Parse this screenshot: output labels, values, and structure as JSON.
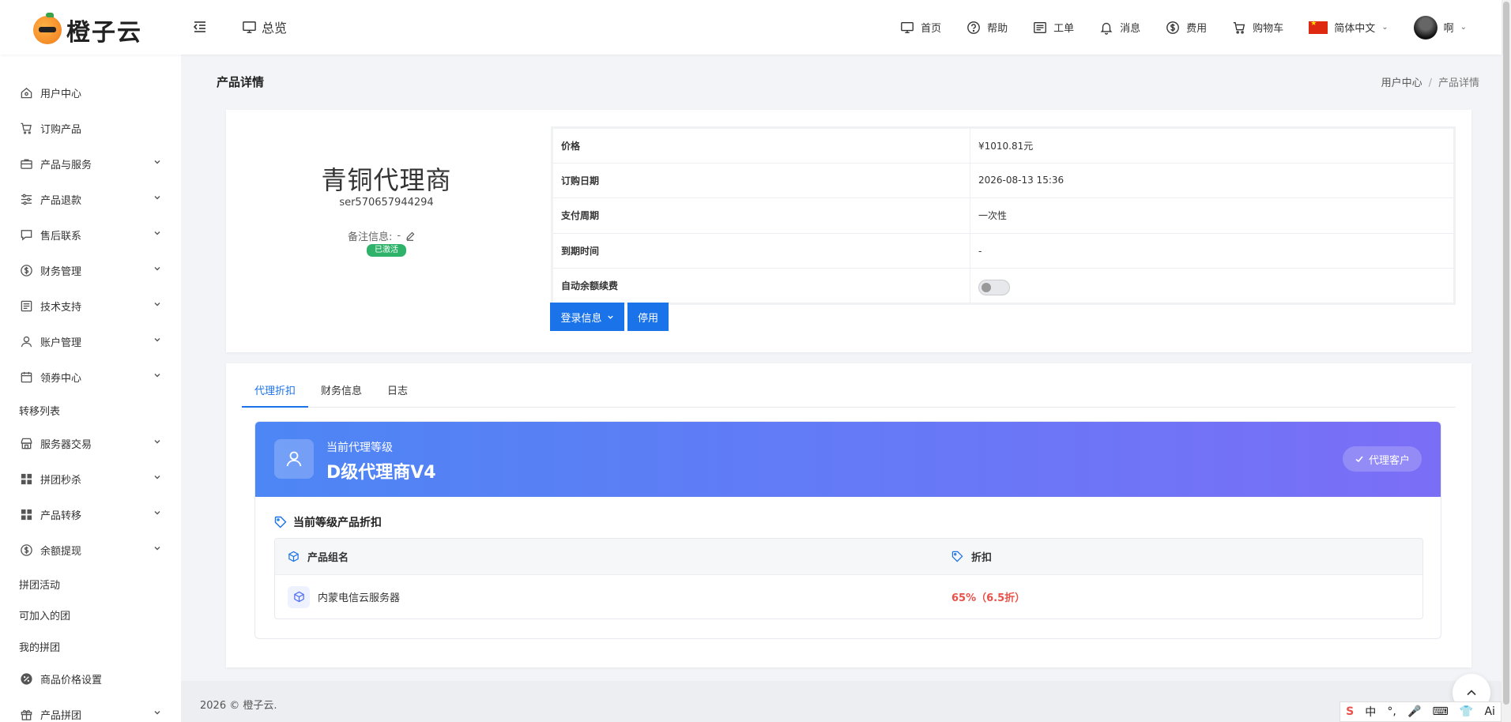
{
  "brand": {
    "name": "橙子云"
  },
  "header": {
    "overview": "总览",
    "nav": [
      {
        "label": "首页",
        "icon": "monitor-icon"
      },
      {
        "label": "帮助",
        "icon": "help-icon"
      },
      {
        "label": "工单",
        "icon": "ticket-icon"
      },
      {
        "label": "消息",
        "icon": "bell-icon"
      },
      {
        "label": "费用",
        "icon": "dollar-icon"
      },
      {
        "label": "购物车",
        "icon": "cart-icon"
      }
    ],
    "language": "简体中文",
    "user": "啊"
  },
  "sidebar": {
    "items": [
      {
        "label": "用户中心",
        "icon": "home-icon",
        "expandable": false
      },
      {
        "label": "订购产品",
        "icon": "cart-icon",
        "expandable": false
      },
      {
        "label": "产品与服务",
        "icon": "briefcase-icon",
        "expandable": true
      },
      {
        "label": "产品退款",
        "icon": "sliders-icon",
        "expandable": true
      },
      {
        "label": "售后联系",
        "icon": "chat-icon",
        "expandable": true
      },
      {
        "label": "财务管理",
        "icon": "dollar-circle-icon",
        "expandable": true
      },
      {
        "label": "技术支持",
        "icon": "document-icon",
        "expandable": true
      },
      {
        "label": "账户管理",
        "icon": "user-icon",
        "expandable": true
      },
      {
        "label": "领券中心",
        "icon": "calendar-icon",
        "expandable": true
      },
      {
        "label": "转移列表",
        "icon": "",
        "expandable": false
      },
      {
        "label": "服务器交易",
        "icon": "store-icon",
        "expandable": true
      },
      {
        "label": "拼团秒杀",
        "icon": "grid-icon",
        "expandable": true
      },
      {
        "label": "产品转移",
        "icon": "grid-icon",
        "expandable": true
      },
      {
        "label": "余额提现",
        "icon": "dollar-circle-icon",
        "expandable": true
      },
      {
        "label": "拼团活动",
        "icon": "",
        "expandable": false
      },
      {
        "label": "可加入的团",
        "icon": "",
        "expandable": false
      },
      {
        "label": "我的拼团",
        "icon": "",
        "expandable": false
      },
      {
        "label": "商品价格设置",
        "icon": "percent-badge-icon",
        "expandable": false
      },
      {
        "label": "产品拼团",
        "icon": "gift-icon",
        "expandable": true
      }
    ]
  },
  "page": {
    "title": "产品详情",
    "breadcrumb": {
      "parent": "用户中心",
      "separator": "/",
      "current": "产品详情"
    }
  },
  "product": {
    "name": "青铜代理商",
    "id": "ser570657944294",
    "remark_label": "备注信息:",
    "remark_value": "-",
    "status": "已激活",
    "details": [
      {
        "label": "价格",
        "value": "¥1010.81元"
      },
      {
        "label": "订购日期",
        "value": "2026-08-13 15:36"
      },
      {
        "label": "支付周期",
        "value": "一次性"
      },
      {
        "label": "到期时间",
        "value": "-"
      },
      {
        "label": "自动余额续费",
        "value": ""
      }
    ],
    "auto_renew_enabled": false,
    "buttons": {
      "login_info": "登录信息",
      "stop": "停用"
    }
  },
  "tabs": [
    {
      "label": "代理折扣",
      "active": true
    },
    {
      "label": "财务信息",
      "active": false
    },
    {
      "label": "日志",
      "active": false
    }
  ],
  "agent": {
    "current_level_label": "当前代理等级",
    "level_name": "D级代理商V4",
    "agent_button": "代理客户",
    "discount_title": "当前等级产品折扣",
    "table_headers": {
      "group": "产品组名",
      "discount": "折扣"
    },
    "rows": [
      {
        "group": "内蒙电信云服务器",
        "discount": "65%（6.5折）"
      }
    ]
  },
  "footer": {
    "text": "2026 © 橙子云."
  },
  "ime": {
    "s": "S",
    "lang": "中",
    "items": [
      "°,",
      "🎤",
      "⌨",
      "👕",
      "Ai"
    ]
  },
  "colors": {
    "primary": "#1a73e8",
    "success": "#2fb36b",
    "discount": "#e8524a",
    "banner_start": "#4d86f5",
    "banner_end": "#7b6ef6"
  }
}
